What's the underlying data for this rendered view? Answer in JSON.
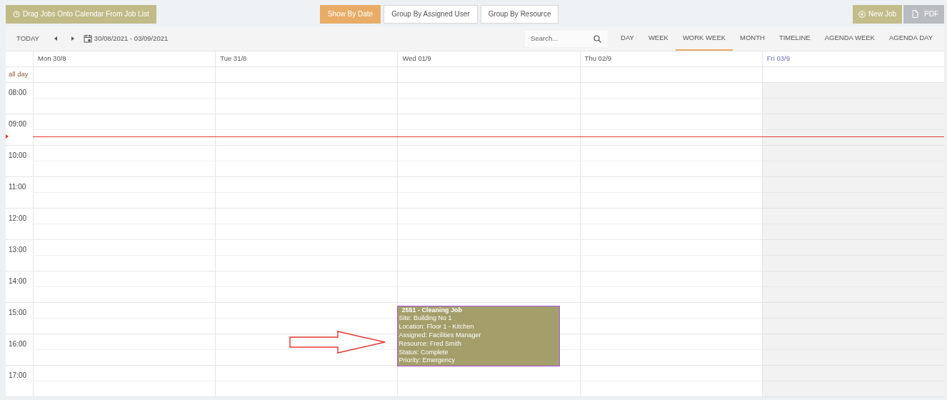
{
  "top_bar": {
    "drag_button": "Drag Jobs Onto Calendar From Job List",
    "group_buttons": [
      {
        "label": "Show By Date",
        "selected": true
      },
      {
        "label": "Group By Assigned User",
        "selected": false
      },
      {
        "label": "Group By Resource",
        "selected": false
      }
    ],
    "actions": [
      {
        "label": "New Job",
        "kind": "new"
      },
      {
        "label": "PDF",
        "kind": "pdf"
      }
    ]
  },
  "toolbar": {
    "today": "TODAY",
    "date_range": "30/08/2021 - 03/09/2021",
    "search": {
      "placeholder": "Search..."
    },
    "views": [
      {
        "label": "DAY",
        "selected": false
      },
      {
        "label": "WEEK",
        "selected": false
      },
      {
        "label": "WORK WEEK",
        "selected": true
      },
      {
        "label": "MONTH",
        "selected": false
      },
      {
        "label": "TIMELINE",
        "selected": false
      },
      {
        "label": "AGENDA WEEK",
        "selected": false
      },
      {
        "label": "AGENDA DAY",
        "selected": false
      }
    ]
  },
  "calendar": {
    "all_day_label": "all day",
    "days": [
      {
        "label": "Mon 30/8",
        "today": false
      },
      {
        "label": "Tue 31/8",
        "today": false
      },
      {
        "label": "Wed 01/9",
        "today": false
      },
      {
        "label": "Thu 02/9",
        "today": false
      },
      {
        "label": "Fri 03/9",
        "today": true
      }
    ],
    "hours": [
      "08:00",
      "09:00",
      "10:00",
      "11:00",
      "12:00",
      "13:00",
      "14:00",
      "15:00",
      "16:00",
      "17:00"
    ],
    "events": [
      {
        "title": "2551 - Cleaning Job",
        "lines": [
          "Site: Building No 1",
          "Location: Floor 1 - Kitchen",
          "Assigned: Facilities Manager",
          "Resource: Fred Smith",
          "Status: Complete",
          "Priority: Emergency"
        ]
      }
    ]
  }
}
